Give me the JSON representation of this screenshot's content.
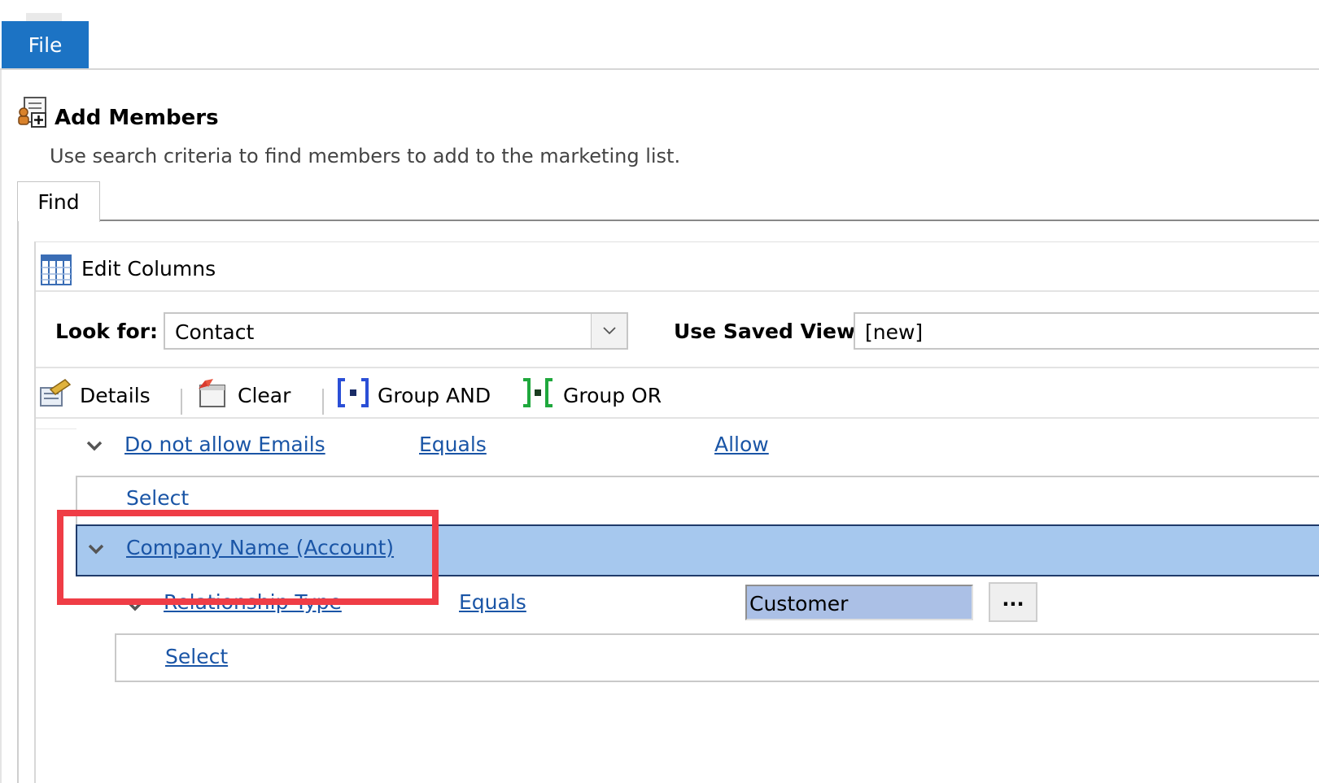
{
  "ribbon": {
    "file_label": "File"
  },
  "dialog": {
    "title": "Add Members",
    "subtitle": "Use search criteria to find members to add to the marketing list.",
    "tab_label": "Find"
  },
  "edit_columns": {
    "label": "Edit Columns"
  },
  "look_for": {
    "label": "Look for:",
    "value": "Contact"
  },
  "saved_view": {
    "label": "Use Saved View:",
    "value": "[new]"
  },
  "toolbar": {
    "details": "Details",
    "clear": "Clear",
    "group_and": "Group AND",
    "group_or": "Group OR"
  },
  "criteria": {
    "row1": {
      "field": "Do not allow Emails",
      "operator": "Equals",
      "value": "Allow"
    },
    "row1_select": "Select",
    "company": {
      "field": "Company Name (Account)"
    },
    "rel": {
      "field": "Relationship Type",
      "operator": "Equals",
      "value": "Customer",
      "lookup_btn": "..."
    },
    "rel_select": "Select"
  },
  "colors": {
    "file_tab": "#1c73c4",
    "selected_row": "#a6c8ee",
    "link": "#1a55a6",
    "highlight": "#ef3d46"
  }
}
